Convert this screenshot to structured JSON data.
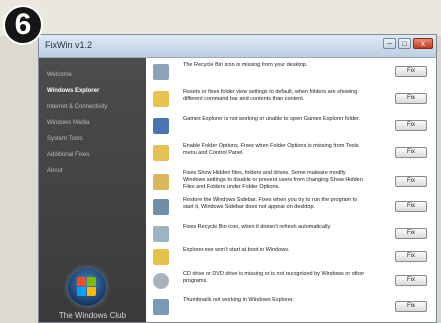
{
  "step_number": "6",
  "window": {
    "title": "FixWin v1.2",
    "controls": {
      "minimize": "–",
      "maximize": "□",
      "close": "x"
    }
  },
  "sidebar": {
    "items": [
      {
        "label": "Welcome",
        "active": false
      },
      {
        "label": "Windows Explorer",
        "active": true
      },
      {
        "label": "Internet & Connectivity",
        "active": false
      },
      {
        "label": "Windows Media",
        "active": false
      },
      {
        "label": "System Tools",
        "active": false
      },
      {
        "label": "Additional Fixes",
        "active": false
      },
      {
        "label": "About",
        "active": false
      }
    ],
    "footer": "The Windows Club"
  },
  "fixes": [
    {
      "text": "The Recycle Bin icon is missing from your desktop.",
      "button": "Fix",
      "icon": "recycle-bin-icon",
      "color": "#8aa3b8"
    },
    {
      "text": "Resets or fixes folder view settings to default, when folders are showing different command bar and contents than content.",
      "button": "Fix",
      "icon": "folder-icon",
      "color": "#e7c44f"
    },
    {
      "text": "Games Explorer is not working or unable to open Games Explorer folder.",
      "button": "Fix",
      "icon": "games-explorer-icon",
      "color": "#4a75b3"
    },
    {
      "text": "Enable Folder Options. Fixes when Folder Options is missing from Tools menu and Control Panel.",
      "button": "Fix",
      "icon": "folder-options-icon",
      "color": "#e6c052"
    },
    {
      "text": "Fixes Show Hidden files, folders and drives. Some malware modify Windows settings to disable or prevent users from changing Show Hidden Files and Folders under Folder Options.",
      "button": "Fix",
      "icon": "hidden-files-icon",
      "color": "#d9b85a"
    },
    {
      "text": "Restore the Windows Sidebar. Fixes when you try to run the program to start it, Windows Sidebar does not appear on desktop.",
      "button": "Fix",
      "icon": "sidebar-icon",
      "color": "#6f8fa8"
    },
    {
      "text": "Fixes Recycle Bin icon, when it doesn't refresh automatically.",
      "button": "Fix",
      "icon": "recycle-bin-refresh-icon",
      "color": "#9db4c4"
    },
    {
      "text": "Explorer.exe won't start at boot in Windows.",
      "button": "Fix",
      "icon": "explorer-icon",
      "color": "#e3c24a"
    },
    {
      "text": "CD drive or DVD drive is missing or is not recognized by Windows or other programs.",
      "button": "Fix",
      "icon": "cd-drive-icon",
      "color": "#a9b2ba"
    },
    {
      "text": "Thumbnails not working in Windows Explorer.",
      "button": "Fix",
      "icon": "thumbnails-icon",
      "color": "#7d9ab5"
    }
  ]
}
